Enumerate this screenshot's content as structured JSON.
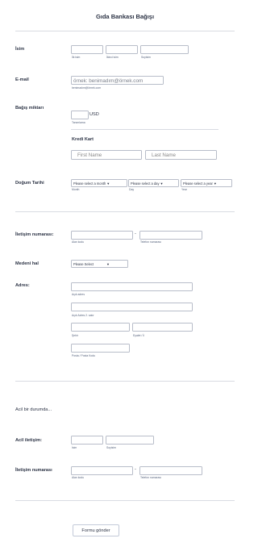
{
  "title": "Gıda Bankası Bağışı",
  "name_section": {
    "label": "İsim",
    "first": "İlk isim",
    "middle": "İkinci isim",
    "last": "Soyisim"
  },
  "email_section": {
    "label": "E-mail",
    "placeholder": "örnek: benimadım@örnek.com",
    "sublabel": "benimadım@örnek.com"
  },
  "donation": {
    "label": "Bağış miktarı",
    "currency": "USD",
    "sublabel": "Tanımlama"
  },
  "credit_card": {
    "label": "Kredi Kart",
    "first_placeholder": "First Name",
    "last_placeholder": "Last Name"
  },
  "birth": {
    "label": "Doğum Tarihi",
    "month": "Please select a month",
    "month_sub": "Month",
    "day": "Please select a day",
    "day_sub": "Day",
    "year": "Please select a year",
    "year_sub": "Year"
  },
  "phone": {
    "label": "İletişim numarası:",
    "dash": "-",
    "area": "Alan kodu",
    "number": "Telefon numarası"
  },
  "marital": {
    "label": "Medeni hal",
    "value": "Please Select"
  },
  "address": {
    "label": "Adres:",
    "street": "Açık adres",
    "street2": "Açık Adres 2. satır",
    "city": "Şehir",
    "state": "Eyalet / İl",
    "postal": "Posta / Posta Kodu"
  },
  "emergency_heading": "Acil bir durumda...",
  "emergency_contact": {
    "label": "Acil iletişim:",
    "first": "İsim",
    "last": "Soyisim"
  },
  "emergency_phone": {
    "label": "İletişim numarası",
    "dash": "-",
    "area": "Alan kodu",
    "number": "Telefon numarası"
  },
  "submit_label": "Formu gönder"
}
